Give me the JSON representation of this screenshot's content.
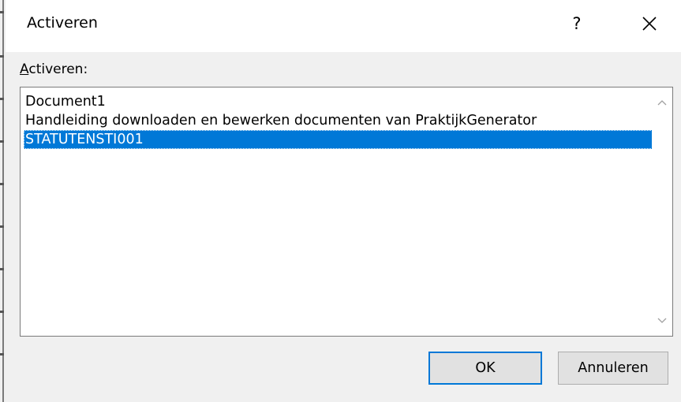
{
  "dialog": {
    "title": "Activeren",
    "help_label": "?",
    "list_label_accel": "A",
    "list_label_rest": "ctiveren:",
    "items": [
      {
        "label": "Document1",
        "selected": false
      },
      {
        "label": "Handleiding downloaden en bewerken documenten van PraktijkGenerator",
        "selected": false
      },
      {
        "label": "STATUTENSTI001",
        "selected": true
      }
    ],
    "ok_label": "OK",
    "cancel_label": "Annuleren"
  },
  "colors": {
    "selection": "#0078d7",
    "titlebar": "#ffffff",
    "background": "#f0f0f0"
  },
  "icons": {
    "close": "close-icon",
    "scroll_up": "chevron-up-icon",
    "scroll_down": "chevron-down-icon"
  }
}
